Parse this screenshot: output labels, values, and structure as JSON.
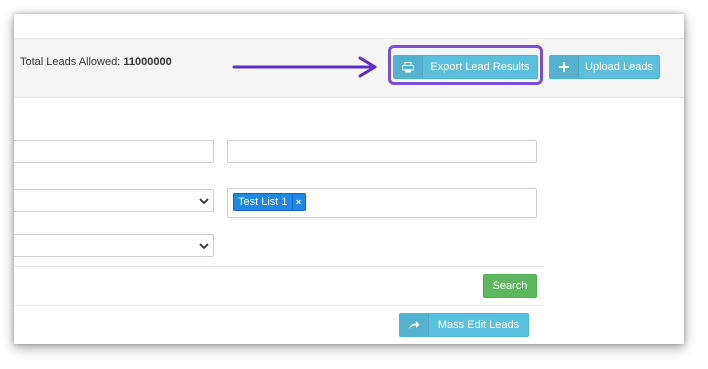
{
  "toolbar": {
    "total_leads_label": "Total Leads Allowed:",
    "total_leads_value": "11000000",
    "export_button": {
      "label": "Export Lead Results",
      "icon": "printer-icon"
    },
    "upload_button": {
      "label": "Upload Leads",
      "icon": "plus-icon"
    }
  },
  "annotation": {
    "highlight_color": "#7a4fd6",
    "arrow_color": "#5b2ec4"
  },
  "form": {
    "list_tag": {
      "label": "Test List 1",
      "remove": "×"
    }
  },
  "actions": {
    "search_label": "Search",
    "mass_edit_label": "Mass Edit Leads",
    "mass_edit_icon": "share-arrow-icon"
  }
}
